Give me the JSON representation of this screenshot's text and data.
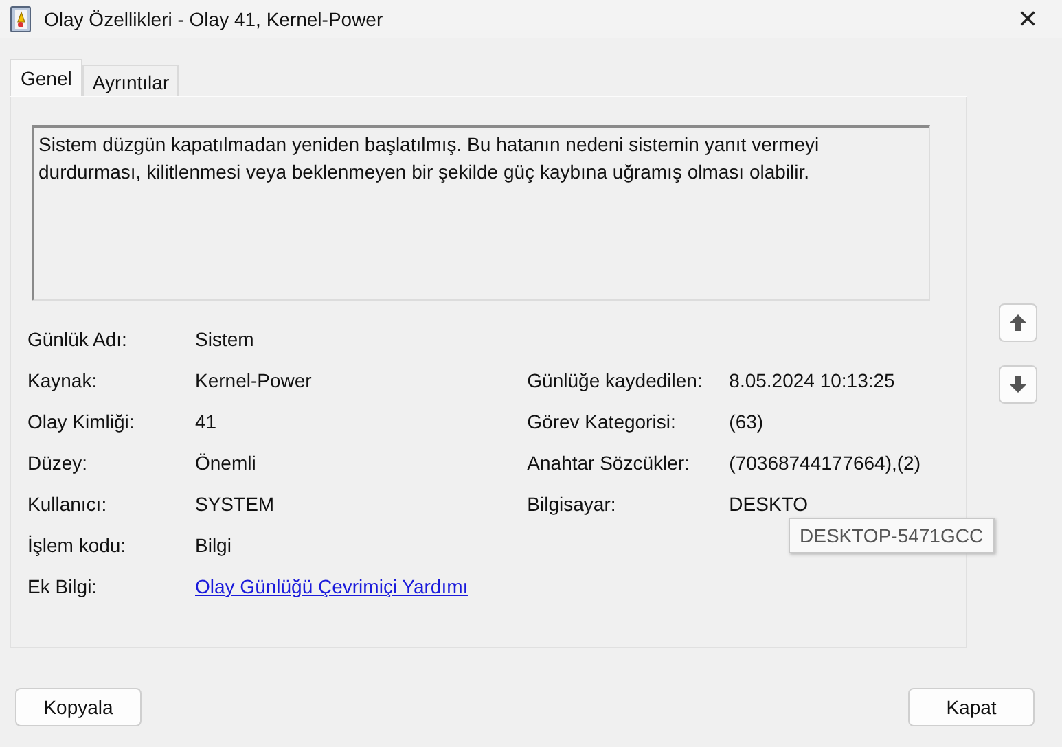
{
  "window": {
    "title": "Olay Özellikleri - Olay 41, Kernel-Power",
    "close": "✕"
  },
  "tabs": [
    {
      "label": "Genel",
      "selected": true
    },
    {
      "label": "Ayrıntılar",
      "selected": false
    }
  ],
  "description": "Sistem düzgün kapatılmadan yeniden başlatılmış. Bu hatanın nedeni sistemin yanıt vermeyi durdurması, kilitlenmesi veya beklenmeyen bir şekilde güç kaybına uğramış olması olabilir.",
  "left_fields": [
    {
      "label": "Günlük Adı:",
      "value": "Sistem",
      "kind": "text"
    },
    {
      "label": "Kaynak:",
      "value": "Kernel-Power",
      "kind": "text"
    },
    {
      "label": "Olay Kimliği:",
      "value": "41",
      "kind": "text"
    },
    {
      "label": "Düzey:",
      "value": "Önemli",
      "kind": "text"
    },
    {
      "label": "Kullanıcı:",
      "value": "SYSTEM",
      "kind": "text"
    },
    {
      "label": "İşlem kodu:",
      "value": "Bilgi",
      "kind": "text"
    },
    {
      "label": "Ek Bilgi:",
      "value": "Olay Günlüğü Çevrimiçi Yardımı",
      "kind": "link"
    }
  ],
  "right_fields": [
    {
      "label": "Günlüğe kaydedilen:",
      "value": "8.05.2024 10:13:25",
      "kind": "text"
    },
    {
      "label": "Görev Kategorisi:",
      "value": "(63)",
      "kind": "text"
    },
    {
      "label": "Anahtar Sözcükler:",
      "value": "(70368744177664),(2)",
      "kind": "text"
    },
    {
      "label": "Bilgisayar:",
      "value": "DESKTO",
      "kind": "text"
    }
  ],
  "tooltip": "DESKTOP-5471GCC",
  "buttons": [
    {
      "label": "Kopyala"
    },
    {
      "label": "Kapat"
    }
  ]
}
